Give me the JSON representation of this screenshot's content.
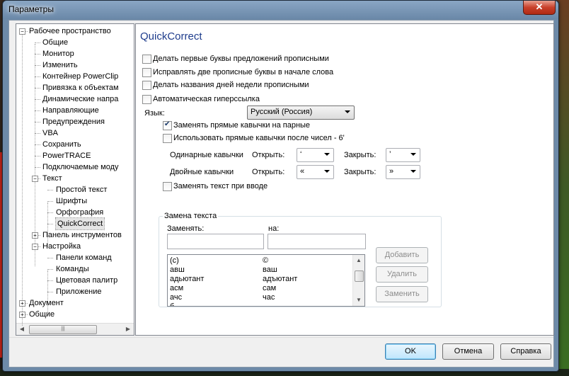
{
  "window": {
    "title": "Параметры",
    "close": "✕"
  },
  "tree": {
    "items": [
      {
        "label": "Рабочее пространство",
        "exp": "−"
      },
      {
        "label": "Общие"
      },
      {
        "label": "Монитор"
      },
      {
        "label": "Изменить"
      },
      {
        "label": "Контейнер PowerClip"
      },
      {
        "label": "Привязка к объектам"
      },
      {
        "label": "Динамические напра"
      },
      {
        "label": "Направляющие"
      },
      {
        "label": "Предупреждения"
      },
      {
        "label": "VBA"
      },
      {
        "label": "Сохранить"
      },
      {
        "label": "PowerTRACE"
      },
      {
        "label": "Подключаемые моду"
      },
      {
        "label": "Текст",
        "exp": "−"
      },
      {
        "label": "Простой текст"
      },
      {
        "label": "Шрифты"
      },
      {
        "label": "Орфография"
      },
      {
        "label": "QuickCorrect"
      },
      {
        "label": "Панель инструментов",
        "exp": "+"
      },
      {
        "label": "Настройка",
        "exp": "−"
      },
      {
        "label": "Панели команд"
      },
      {
        "label": "Команды"
      },
      {
        "label": "Цветовая палитр"
      },
      {
        "label": "Приложение"
      },
      {
        "label": "Документ",
        "exp": "+"
      },
      {
        "label": "Общие",
        "exp": "+"
      }
    ],
    "scroll_left": "◀",
    "scroll_right": "▶",
    "thumb_grip": "|||"
  },
  "panel": {
    "heading": "QuickCorrect",
    "options": {
      "capitalize_sentences": "Делать первые буквы предложений прописными",
      "two_caps": "Исправлять две прописные буквы в начале слова",
      "capitalize_days": "Делать названия дней недели прописными",
      "hyperlink": "Автоматическая гиперссылка"
    },
    "language": {
      "label": "Язык:",
      "value": "Русский (Россия)"
    },
    "smart_quotes": "Заменять прямые кавычки на парные",
    "straight_after_numbers": "Использовать прямые кавычки после чисел - 6'",
    "single_quotes": {
      "label": "Одинарные кавычки",
      "open_label": "Открыть:",
      "open_value": "‘",
      "close_label": "Закрыть:",
      "close_value": "’"
    },
    "double_quotes": {
      "label": "Двойные кавычки",
      "open_label": "Открыть:",
      "open_value": "«",
      "close_label": "Закрыть:",
      "close_value": "»"
    },
    "replace_while_typing": "Заменять текст при вводе",
    "replace_group": {
      "title": "Замена текста",
      "replace_label": "Заменять:",
      "with_label": "на:",
      "rows": [
        [
          "(c)",
          "©"
        ],
        [
          "авш",
          "ваш"
        ],
        [
          "адьютант",
          "адъютант"
        ],
        [
          "асм",
          "сам"
        ],
        [
          "ачс",
          "час"
        ],
        [
          "б",
          ""
        ]
      ],
      "scroll_up": "▲",
      "scroll_down": "▼",
      "add": "Добавить",
      "delete": "Удалить",
      "replace": "Заменить"
    }
  },
  "footer": {
    "ok": "OK",
    "cancel": "Отмена",
    "help": "Справка"
  }
}
